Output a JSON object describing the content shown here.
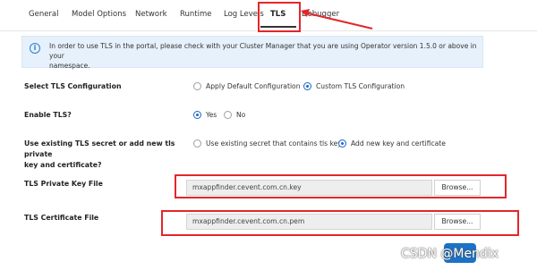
{
  "tabs": [
    {
      "label": "General"
    },
    {
      "label": "Model Options"
    },
    {
      "label": "Network"
    },
    {
      "label": "Runtime"
    },
    {
      "label": "Log Levels"
    },
    {
      "label": "TLS",
      "active": true
    },
    {
      "label": "Debugger"
    }
  ],
  "info_banner": {
    "icon": "info-icon",
    "line1": "In order to use TLS in the portal, please check with your Cluster Manager that you are using Operator version 1.5.0 or above in your",
    "line2": "namespace."
  },
  "tls_configuration": {
    "label": "Select TLS Configuration",
    "options": [
      {
        "label": "Apply Default Configuration",
        "selected": false
      },
      {
        "label": "Custom TLS Configuration",
        "selected": true
      }
    ]
  },
  "enable_tls": {
    "label": "Enable TLS?",
    "options": [
      {
        "label": "Yes",
        "selected": true
      },
      {
        "label": "No",
        "selected": false
      }
    ]
  },
  "secret_choice": {
    "label_line1": "Use existing TLS secret or add new tls private",
    "label_line2": "key and certificate?",
    "options": [
      {
        "label": "Use existing secret that contains tls key",
        "selected": false
      },
      {
        "label": "Add new key and certificate",
        "selected": true
      }
    ]
  },
  "private_key": {
    "label": "TLS Private Key File",
    "value": "mxappfinder.cevent.com.cn.key",
    "browse_label": "Browse..."
  },
  "certificate": {
    "label": "TLS Certificate File",
    "value": "mxappfinder.cevent.com.cn.pem",
    "browse_label": "Browse..."
  },
  "watermark": "CSDN @Mendix",
  "colors": {
    "accent": "#1a66c2",
    "annotation_red": "#e3262b",
    "banner_bg": "#e6f1fb"
  }
}
